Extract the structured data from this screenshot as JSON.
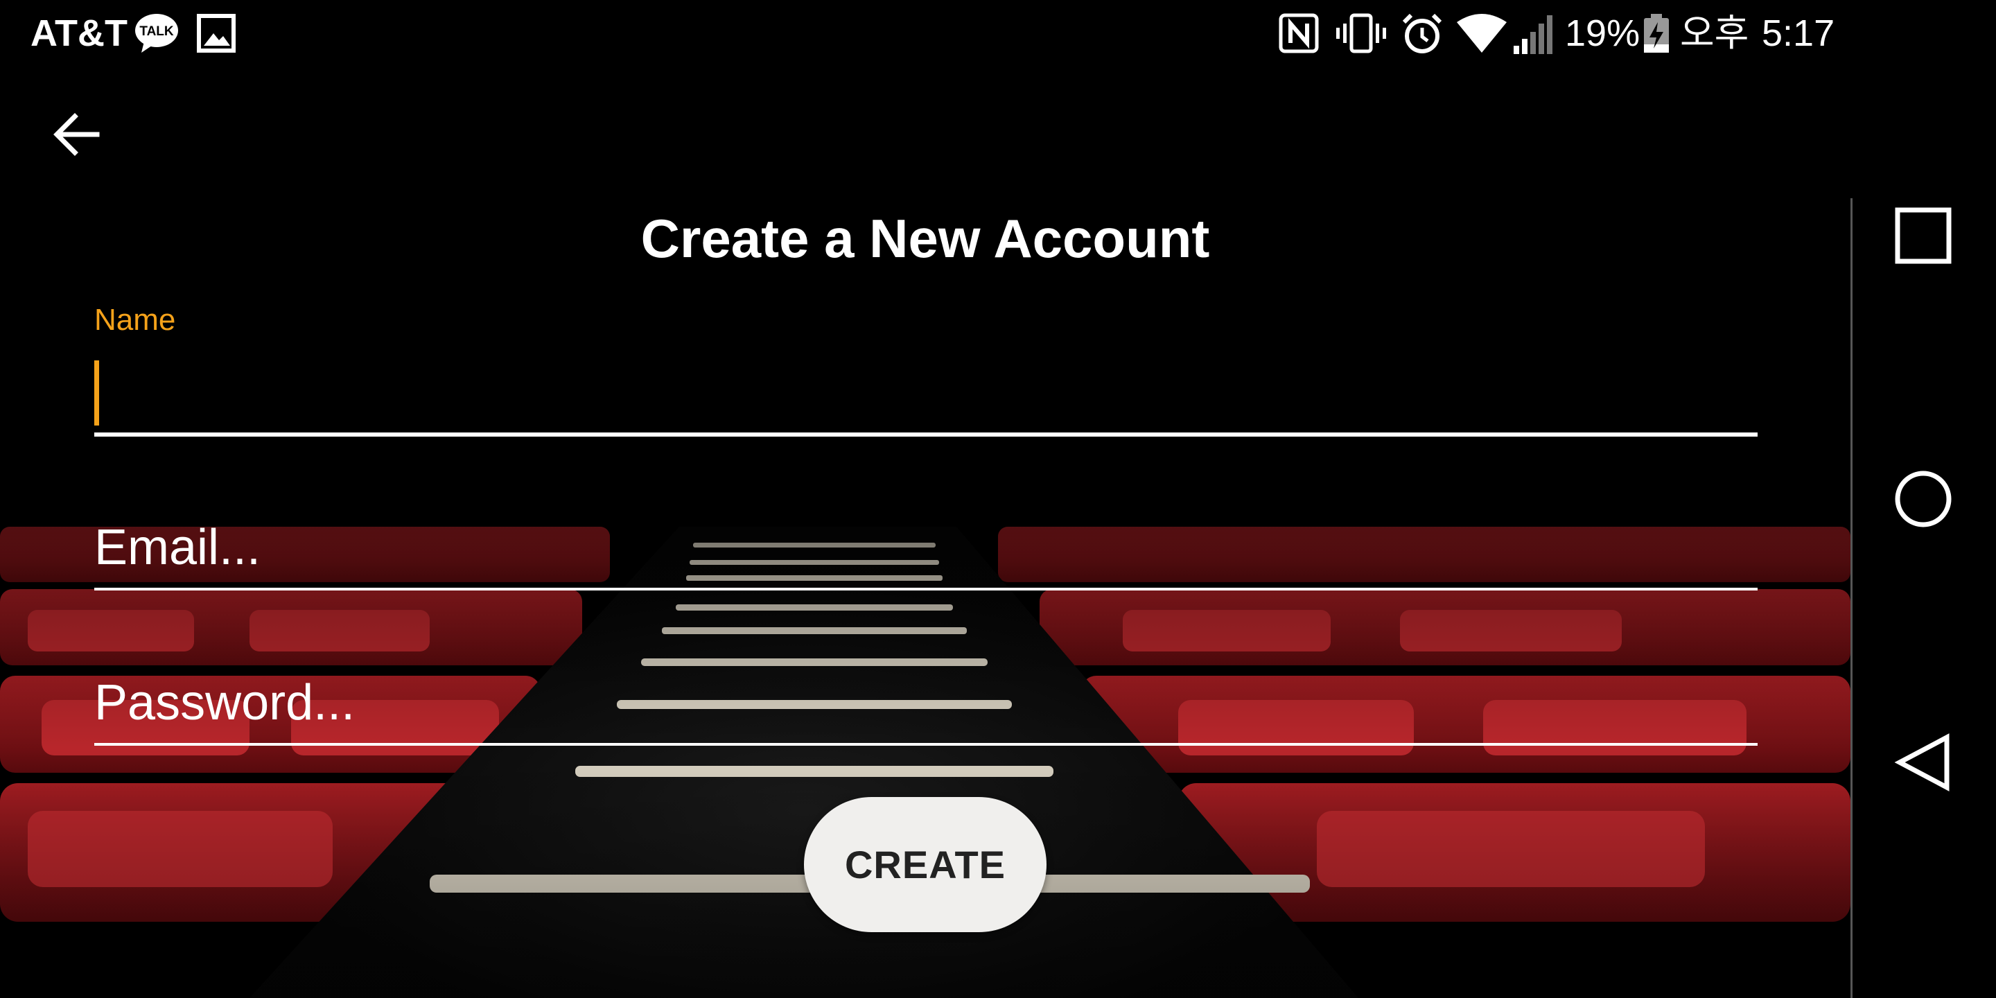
{
  "status_bar": {
    "carrier": "AT&T",
    "talk_badge": "TALK",
    "battery_percent": "19%",
    "ampm": "오후",
    "time": "5:17",
    "icons": [
      "kakaotalk-icon",
      "gallery-icon",
      "nfc-icon",
      "vibrate-icon",
      "alarm-icon",
      "wifi-icon",
      "signal-icon",
      "battery-charging-icon"
    ]
  },
  "app_bar": {
    "back_icon": "arrow-left-icon"
  },
  "page": {
    "title": "Create a New Account"
  },
  "form": {
    "name": {
      "label": "Name",
      "value": "",
      "focused": true
    },
    "email": {
      "placeholder": "Email...",
      "value": ""
    },
    "password": {
      "placeholder": "Password...",
      "value": ""
    },
    "submit_label": "CREATE"
  },
  "nav_bar": {
    "items": [
      "recents-square-icon",
      "home-circle-icon",
      "back-triangle-icon"
    ]
  },
  "colors": {
    "accent": "#f5a21a",
    "seat_red": "#8e1418",
    "background": "#000000",
    "button_bg": "#f0efed"
  }
}
